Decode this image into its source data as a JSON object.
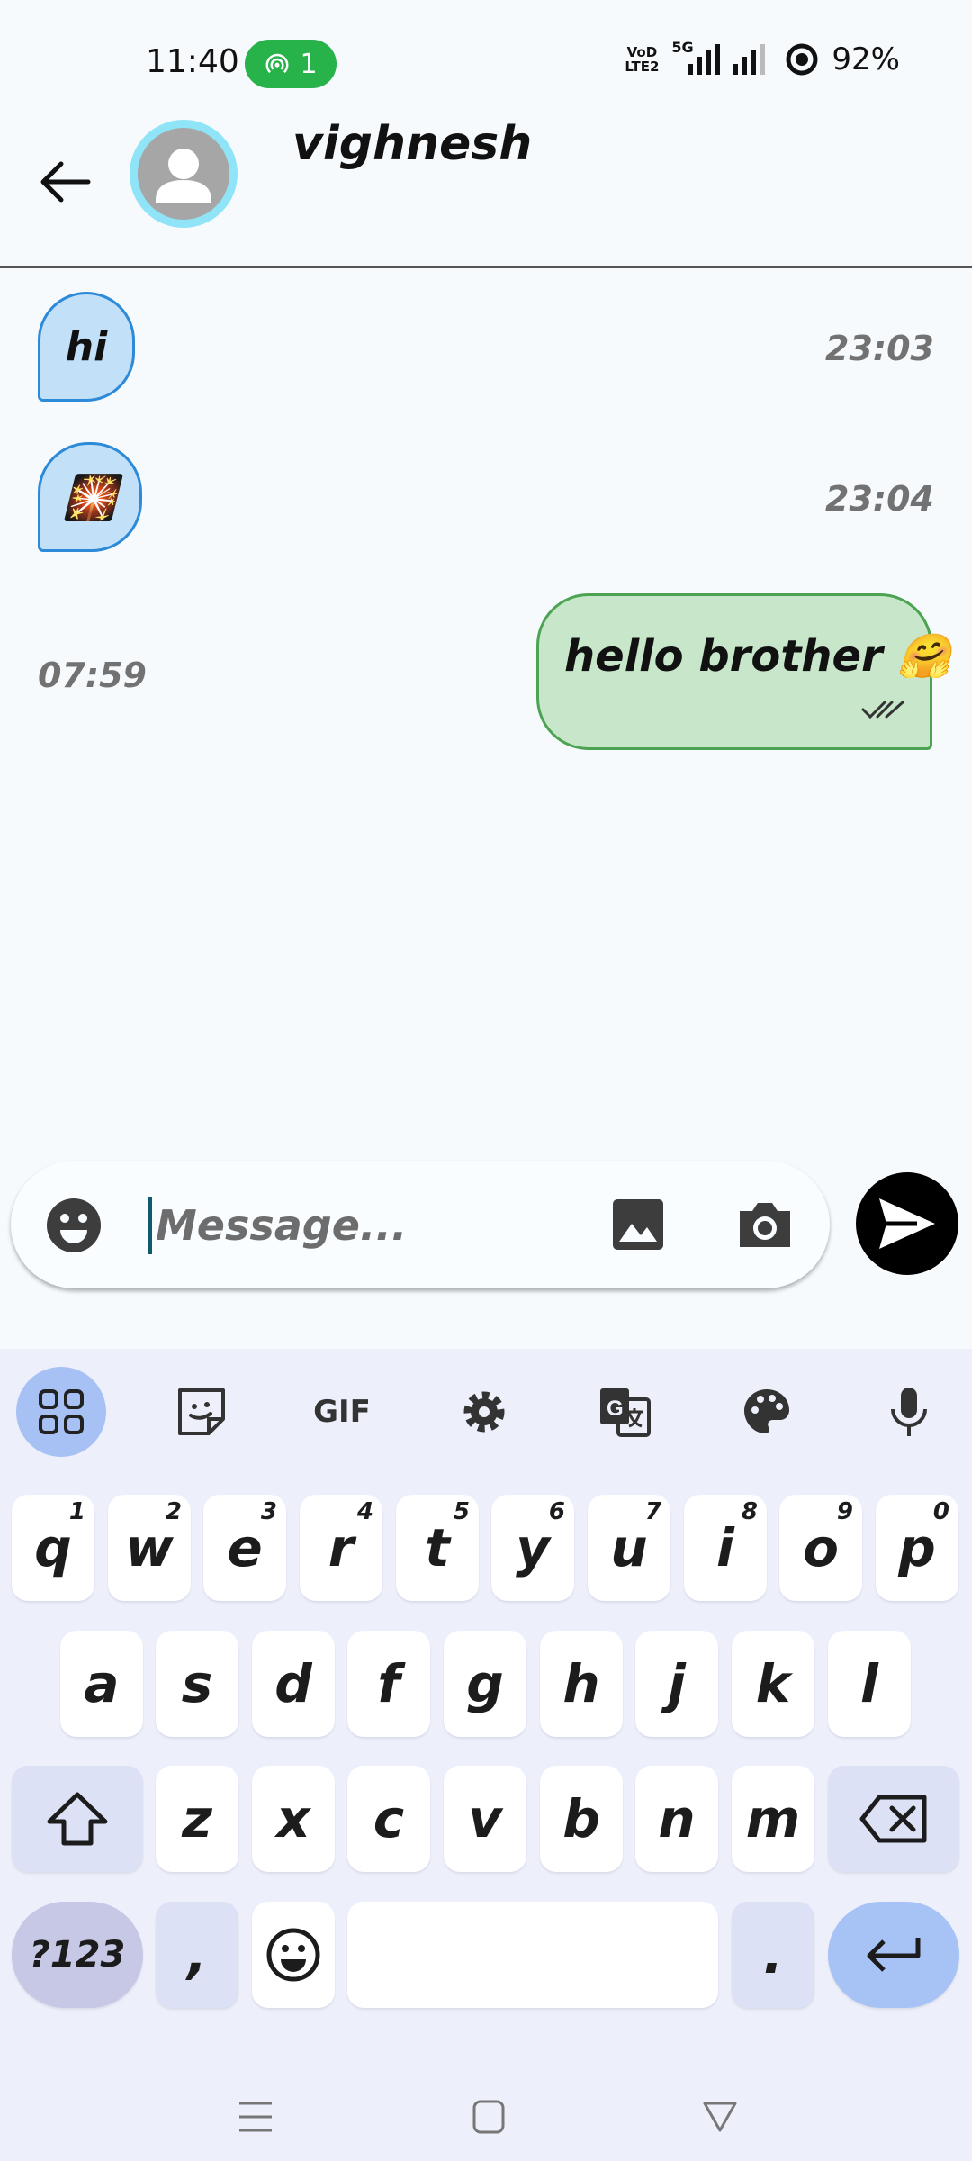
{
  "status_bar": {
    "time": "11:40",
    "hotspot_count": "1",
    "volte_line1": "VoD",
    "volte_line2": "LTE2",
    "network": "5G",
    "battery": "92%"
  },
  "header": {
    "contact_name": "vighnesh"
  },
  "messages": [
    {
      "direction": "in",
      "text": "hi",
      "time": "23:03"
    },
    {
      "direction": "in",
      "text": "🎇",
      "time": "23:04"
    },
    {
      "direction": "out",
      "text": "hello brother 🤗",
      "time": "07:59",
      "status": "read"
    }
  ],
  "composer": {
    "placeholder": "Message..."
  },
  "keyboard": {
    "toolbar": [
      "apps-icon",
      "sticker-icon",
      "GIF",
      "settings-icon",
      "translate-icon",
      "palette-icon",
      "mic-icon"
    ],
    "gif_label": "GIF",
    "row1": [
      {
        "key": "q",
        "hint": "1"
      },
      {
        "key": "w",
        "hint": "2"
      },
      {
        "key": "e",
        "hint": "3"
      },
      {
        "key": "r",
        "hint": "4"
      },
      {
        "key": "t",
        "hint": "5"
      },
      {
        "key": "y",
        "hint": "6"
      },
      {
        "key": "u",
        "hint": "7"
      },
      {
        "key": "i",
        "hint": "8"
      },
      {
        "key": "o",
        "hint": "9"
      },
      {
        "key": "p",
        "hint": "0"
      }
    ],
    "row2": [
      "a",
      "s",
      "d",
      "f",
      "g",
      "h",
      "j",
      "k",
      "l"
    ],
    "row3": [
      "z",
      "x",
      "c",
      "v",
      "b",
      "n",
      "m"
    ],
    "symbols_label": "?123",
    "comma": ",",
    "period": "."
  },
  "colors": {
    "incoming_bubble": "#c2e0f8",
    "outgoing_bubble": "#c8e7ca",
    "hotspot": "#27b24a",
    "enter_key": "#a7c3f6"
  }
}
